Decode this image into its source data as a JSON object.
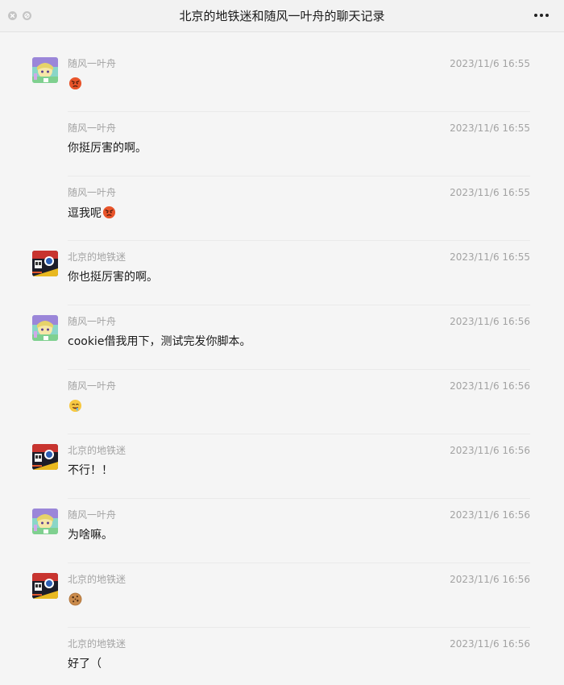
{
  "window": {
    "title": "北京的地铁迷和随风一叶舟的聊天记录"
  },
  "colors": {
    "background": "#f5f5f5",
    "meta_text": "#a3a3a3",
    "separator": "#eaeaea"
  },
  "messages": [
    {
      "sender": "随风一叶舟",
      "time": "2023/11/6 16:55",
      "text": "",
      "emoji": "angry-face-icon",
      "avatar": "anime-girl-avatar"
    },
    {
      "sender": "随风一叶舟",
      "time": "2023/11/6 16:55",
      "text": "你挺厉害的啊。",
      "emoji": "",
      "avatar": ""
    },
    {
      "sender": "随风一叶舟",
      "time": "2023/11/6 16:55",
      "text": "逗我呢",
      "emoji": "angry-face-icon",
      "avatar": ""
    },
    {
      "sender": "北京的地铁迷",
      "time": "2023/11/6 16:55",
      "text": "你也挺厉害的啊。",
      "emoji": "",
      "avatar": "subway-avatar"
    },
    {
      "sender": "随风一叶舟",
      "time": "2023/11/6 16:56",
      "text": "cookie借我用下，测试完发你脚本。",
      "emoji": "",
      "avatar": "anime-girl-avatar"
    },
    {
      "sender": "随风一叶舟",
      "time": "2023/11/6 16:56",
      "text": "",
      "emoji": "drooling-face-icon",
      "avatar": ""
    },
    {
      "sender": "北京的地铁迷",
      "time": "2023/11/6 16:56",
      "text": "不行！！",
      "emoji": "",
      "avatar": "subway-avatar"
    },
    {
      "sender": "随风一叶舟",
      "time": "2023/11/6 16:56",
      "text": "为啥嘛。",
      "emoji": "",
      "avatar": "anime-girl-avatar"
    },
    {
      "sender": "北京的地铁迷",
      "time": "2023/11/6 16:56",
      "text": "",
      "emoji": "cookie-icon",
      "avatar": "subway-avatar"
    },
    {
      "sender": "北京的地铁迷",
      "time": "2023/11/6 16:56",
      "text": "好了（",
      "emoji": "",
      "avatar": ""
    }
  ]
}
